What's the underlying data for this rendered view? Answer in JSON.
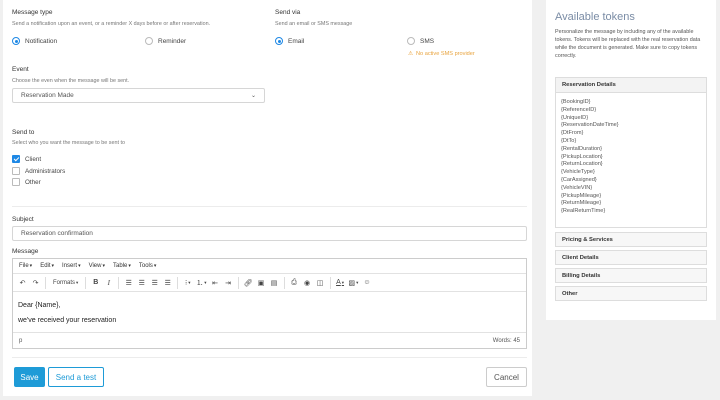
{
  "message_type": {
    "label": "Message type",
    "help": "Send a notification upon an event, or a reminder X days before or after reservation.",
    "options": [
      "Notification",
      "Reminder"
    ],
    "selected": "Notification"
  },
  "send_via": {
    "label": "Send via",
    "help": "Send an email or SMS message",
    "options": [
      "Email",
      "SMS"
    ],
    "selected": "Email",
    "warning": "No active SMS provider"
  },
  "event": {
    "label": "Event",
    "help": "Choose the even when the message will be sent.",
    "value": "Reservation Made"
  },
  "send_to": {
    "label": "Send to",
    "help": "Select who you want the message to be sent to",
    "options": [
      {
        "label": "Client",
        "checked": true
      },
      {
        "label": "Administrators",
        "checked": false
      },
      {
        "label": "Other",
        "checked": false
      }
    ]
  },
  "subject": {
    "label": "Subject",
    "value": "Reservation confirmation"
  },
  "message": {
    "label": "Message",
    "menus": [
      "File",
      "Edit",
      "Insert",
      "View",
      "Table",
      "Tools"
    ],
    "format_label": "Formats",
    "content_lines": [
      "Dear {Name},",
      "we've received your reservation"
    ],
    "path": "p",
    "word_count": "Words: 45"
  },
  "buttons": {
    "save": "Save",
    "test": "Send a test",
    "cancel": "Cancel"
  },
  "tokens": {
    "title": "Available tokens",
    "description": "Personalize the message by including any of the available tokens. Tokens will be replaced with the real reservation data while the document is generated. Make sure to copy tokens correctly.",
    "sections": [
      "Reservation Details",
      "Pricing & Services",
      "Client Details",
      "Billing Details",
      "Other"
    ],
    "reservation_tokens": [
      "{BookingID}",
      "{ReferenceID}",
      "{UniqueID}",
      "{ReservationDateTime}",
      "{DtFrom}",
      "{DtTo}",
      "{RentalDuration}",
      "{PickupLocation}",
      "{ReturnLocation}",
      "{VehicleType}",
      "{CarAssigned}",
      "{VehicleVIN}",
      "{PickupMileage}",
      "{ReturnMileage}",
      "{RealReturnTime}"
    ]
  },
  "colors": {
    "accent": "#1e9bd7",
    "warning": "#e8a33d",
    "token_title": "#7a8ca5"
  }
}
